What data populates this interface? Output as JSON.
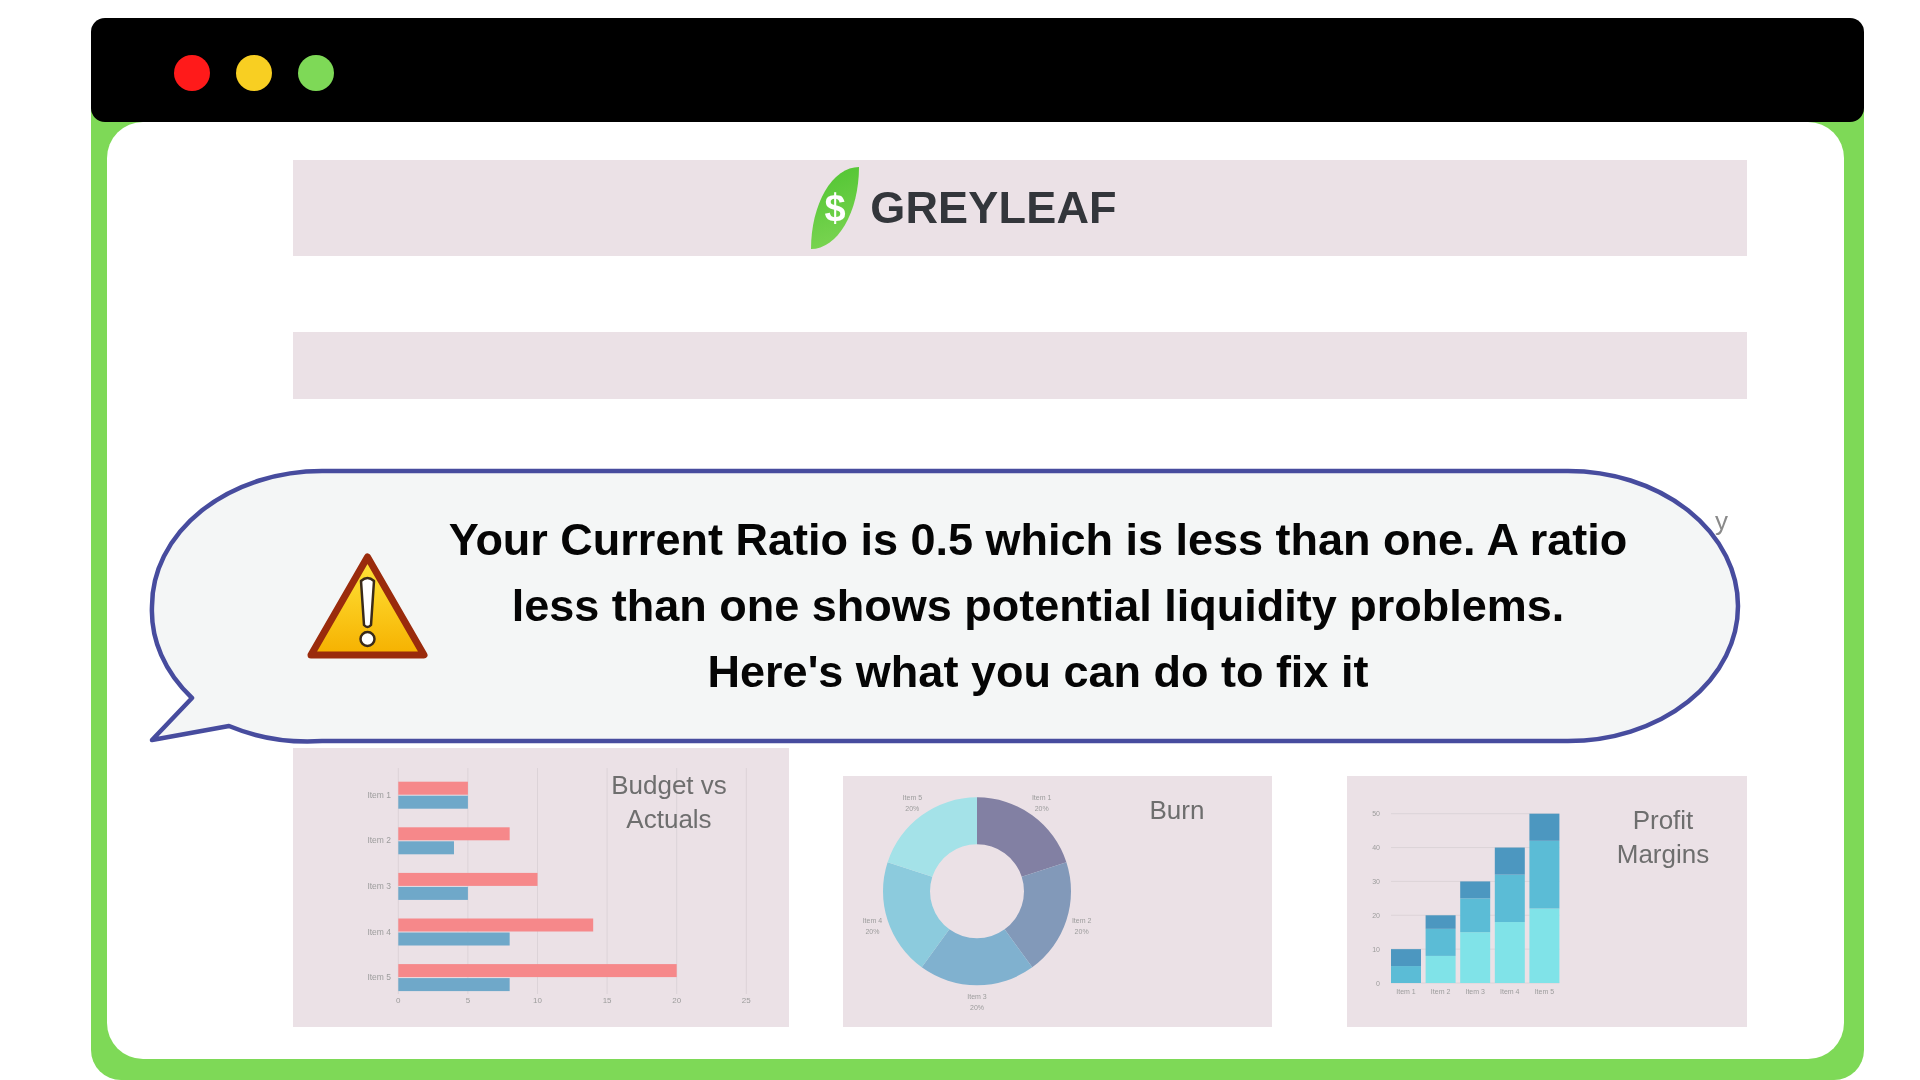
{
  "window": {
    "controls": [
      {
        "color": "#ff1a1a"
      },
      {
        "color": "#f8cf22"
      },
      {
        "color": "#7ed957"
      }
    ]
  },
  "header": {
    "logo_mark": "$",
    "logo_text": "GREYLEAF"
  },
  "covered_heading": {
    "text": "y"
  },
  "alert": {
    "lines": [
      "Your Current Ratio is 0.5 which is less than one. A ratio",
      "less than one shows potential liquidity problems.",
      "Here's what you can do to fix it"
    ]
  },
  "charts": [
    {
      "chart_data": {
        "type": "bar",
        "orientation": "horizontal",
        "title": "Budget vs Actuals",
        "categories": [
          "Item 1",
          "Item 2",
          "Item 3",
          "Item 4",
          "Item 5"
        ],
        "series": [
          {
            "color": "#f6888a",
            "values": [
              5,
              8,
              10,
              14,
              20
            ]
          },
          {
            "color": "#6fa8c9",
            "values": [
              5,
              4,
              5,
              8,
              8
            ]
          }
        ],
        "xlim": [
          0,
          25
        ],
        "xticks": [
          0,
          5,
          10,
          15,
          20,
          25
        ],
        "grid": true
      }
    },
    {
      "chart_data": {
        "type": "donut",
        "title": "Burn",
        "categories": [
          "Item 1",
          "Item 2",
          "Item 3",
          "Item 4",
          "Item 5"
        ],
        "values": [
          20,
          20,
          20,
          20,
          20
        ],
        "value_labels": [
          "20%",
          "20%",
          "20%",
          "20%",
          "20%"
        ],
        "colors": [
          "#8280a3",
          "#8299b9",
          "#80b1cf",
          "#8ccbdd",
          "#a4e2e8"
        ]
      }
    },
    {
      "chart_data": {
        "type": "bar",
        "stacked": true,
        "title": "Profit Margins",
        "categories": [
          "Item 1",
          "Item 2",
          "Item 3",
          "Item 4",
          "Item 5"
        ],
        "series": [
          {
            "color": "#80e3e8",
            "values": [
              0,
              8,
              15,
              18,
              22
            ]
          },
          {
            "color": "#5bbcd6",
            "values": [
              5,
              8,
              10,
              14,
              20
            ]
          },
          {
            "color": "#4c97c0",
            "values": [
              5,
              4,
              5,
              8,
              8
            ]
          }
        ],
        "ylim": [
          0,
          50
        ],
        "yticks": [
          0,
          10,
          20,
          30,
          40,
          50
        ],
        "grid": true
      }
    }
  ]
}
